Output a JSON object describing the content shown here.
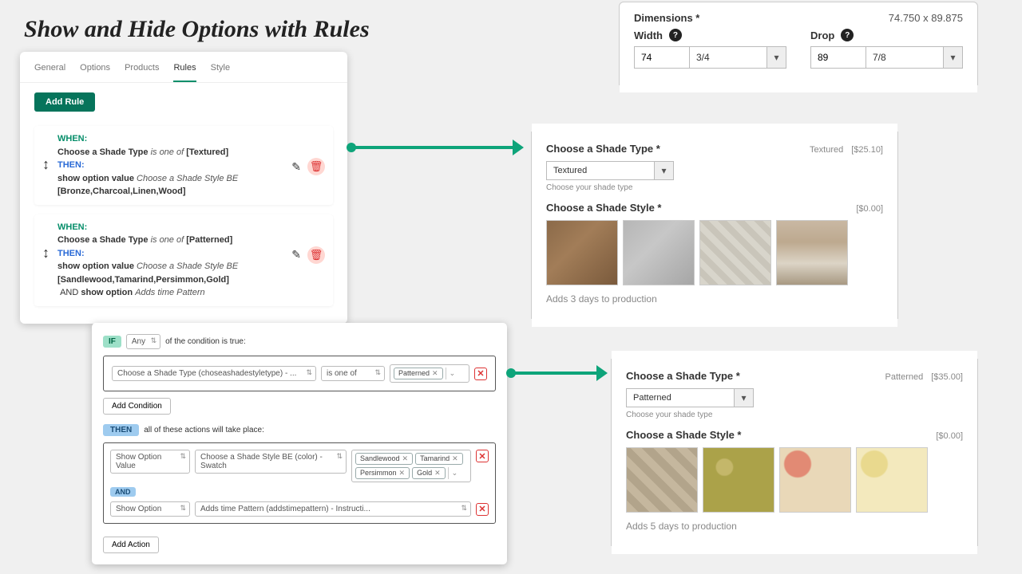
{
  "page_title": "Show and Hide Options with Rules",
  "tabs": [
    "General",
    "Options",
    "Products",
    "Rules",
    "Style"
  ],
  "active_tab": "Rules",
  "add_rule_label": "Add Rule",
  "rules": [
    {
      "when_label": "WHEN:",
      "condition_field": "Choose a Shade Type",
      "condition_op": "is one of",
      "condition_values": "[Textured]",
      "then_label": "THEN:",
      "action_text": "show option value",
      "action_field": "Choose a Shade Style BE",
      "action_values": "[Bronze,Charcoal,Linen,Wood]"
    },
    {
      "when_label": "WHEN:",
      "condition_field": "Choose a Shade Type",
      "condition_op": "is one of",
      "condition_values": "[Patterned]",
      "then_label": "THEN:",
      "action_text": "show option value",
      "action_field": "Choose a Shade Style BE",
      "action_values": "[Sandlewood,Tamarind,Persimmon,Gold]",
      "and_label": "AND",
      "show_option_label": "show option",
      "extra_option": "Adds time Pattern"
    }
  ],
  "rule_builder": {
    "if_label": "IF",
    "any_label": "Any",
    "any_after": "of the condition is true:",
    "cond_field": "Choose a Shade Type (choseashadestyletype) - ...",
    "cond_op": "is one of",
    "cond_tags": [
      "Patterned"
    ],
    "add_condition": "Add Condition",
    "then_label": "THEN",
    "then_after": "all of these actions will take place:",
    "action1_type": "Show Option Value",
    "action1_field": "Choose a Shade Style BE (color) - Swatch",
    "action1_tags": [
      "Sandlewood",
      "Tamarind",
      "Persimmon",
      "Gold"
    ],
    "and_label": "AND",
    "action2_type": "Show Option",
    "action2_field": "Adds time Pattern (addstimepattern) - Instructi...",
    "add_action": "Add Action"
  },
  "dimensions": {
    "title": "Dimensions *",
    "computed": "74.750 x 89.875",
    "width_label": "Width",
    "width_val": "74",
    "width_frac": "3/4",
    "drop_label": "Drop",
    "drop_val": "89",
    "drop_frac": "7/8"
  },
  "shade_top": {
    "type_title": "Choose a Shade Type *",
    "selected": "Textured",
    "price": "[$25.10]",
    "select_val": "Textured",
    "help": "Choose your shade type",
    "style_title": "Choose a Shade Style *",
    "style_price": "[$0.00]",
    "prod_note": "Adds 3 days to production"
  },
  "shade_bottom": {
    "type_title": "Choose a Shade Type *",
    "selected": "Patterned",
    "price": "[$35.00]",
    "select_val": "Patterned",
    "help": "Choose your shade type",
    "style_title": "Choose a Shade Style *",
    "style_price": "[$0.00]",
    "prod_note": "Adds 5 days to production"
  }
}
